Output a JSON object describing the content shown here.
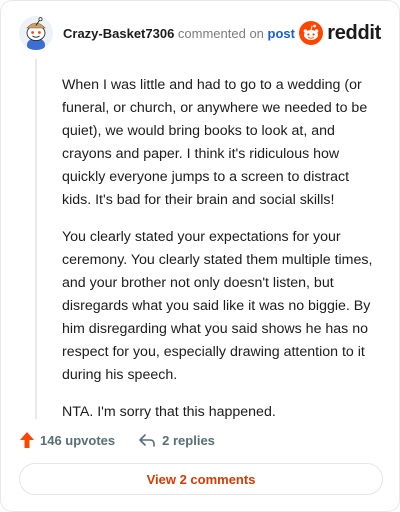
{
  "comment": {
    "author": "Crazy-Basket7306",
    "action_text": "commented on",
    "post_link": "post",
    "brand": "reddit",
    "paragraphs": [
      "When I was little and had to go to a wedding (or funeral, or church, or anywhere we needed to be quiet), we would bring books to look at, and crayons and paper. I think it's ridiculous how quickly everyone jumps to a screen to distract kids. It's bad for their brain and social skills!",
      "You clearly stated your expectations for your ceremony. You clearly stated them multiple times, and your brother not only doesn't listen, but disregards what you said like it was no biggie. By him disregarding what you said shows he has no respect for you, especially drawing attention to it during his speech.",
      "NTA. I'm sorry that this happened."
    ],
    "upvotes": "146 upvotes",
    "replies": "2 replies",
    "view_comments": "View 2 comments"
  },
  "colors": {
    "brand_orange": "#ff4500",
    "upvote_orange": "#ff4500",
    "link_blue": "#1a5fcf",
    "view_button_text": "#d93a00"
  },
  "icons": {
    "avatar": "snoo-avatar",
    "brand": "reddit-logo-icon",
    "upvote": "upvote-arrow-icon",
    "reply": "reply-arrow-icon"
  }
}
